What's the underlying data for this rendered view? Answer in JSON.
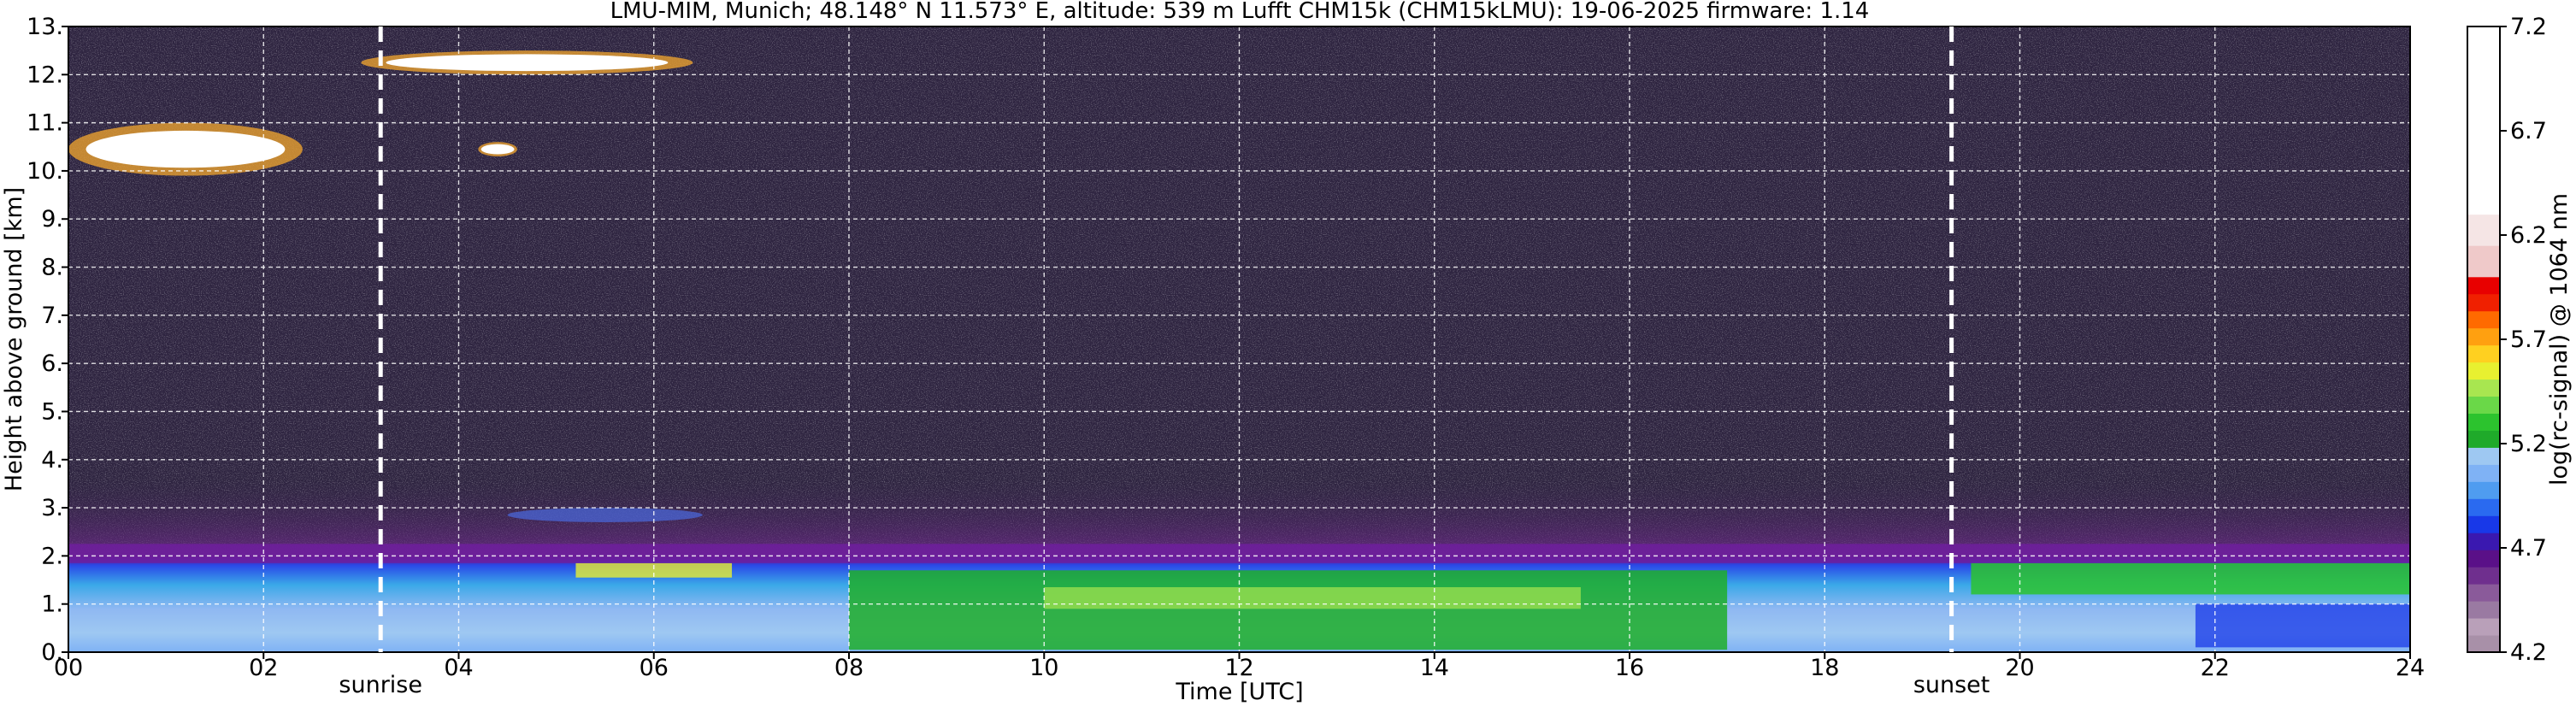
{
  "title": "LMU-MIM, Munich; 48.148° N 11.573° E, altitude: 539 m    Lufft CHM15k (CHM15kLMU): 19-06-2025    firmware: 1.14",
  "chart_data": {
    "type": "heatmap",
    "xlabel": "Time [UTC]",
    "ylabel": "Height above ground [km]",
    "xlim": [
      0,
      24
    ],
    "ylim": [
      0,
      13
    ],
    "x_ticks": [
      "00",
      "02",
      "04",
      "06",
      "08",
      "10",
      "12",
      "14",
      "16",
      "18",
      "20",
      "22",
      "24"
    ],
    "y_ticks": [
      "0.",
      "1.",
      "2.",
      "3.",
      "4.",
      "5.",
      "6.",
      "7.",
      "8.",
      "9.",
      "10.",
      "11.",
      "12.",
      "13."
    ],
    "grid": true,
    "markers": [
      {
        "label": "sunrise",
        "x": 3.2
      },
      {
        "label": "sunset",
        "x": 19.3
      }
    ],
    "colorbar": {
      "label": "log(rc-signal) @ 1064 nm",
      "range": [
        4.2,
        7.2
      ],
      "ticks": [
        "4.2",
        "4.7",
        "5.2",
        "5.7",
        "6.2",
        "6.7",
        "7.2"
      ],
      "colors": [
        "#a890a8",
        "#b9a0b9",
        "#9a7aa2",
        "#8a5a9a",
        "#6f2f8e",
        "#5a1088",
        "#3a18b0",
        "#1838e8",
        "#2a6af0",
        "#4f9cf0",
        "#7fb2f5",
        "#9ec8f2",
        "#1faa2a",
        "#2cc32e",
        "#6ad848",
        "#a8e650",
        "#e8f030",
        "#ffd020",
        "#ffa010",
        "#ff6a00",
        "#f02000",
        "#e80000",
        "#efc9c9",
        "#f5e5e5",
        "#ffffff"
      ]
    },
    "features": [
      {
        "name": "boundary layer aerosol",
        "time": [
          0,
          24
        ],
        "height_km": [
          0,
          2.0
        ]
      },
      {
        "name": "residual/elevated layer",
        "time": [
          0,
          24
        ],
        "height_km": [
          1.8,
          2.2
        ]
      },
      {
        "name": "cirrus cloud",
        "time": [
          3.0,
          6.4
        ],
        "height_km": [
          12.0,
          12.5
        ]
      },
      {
        "name": "cirrus cloud",
        "time": [
          0.0,
          2.4
        ],
        "height_km": [
          9.9,
          11.0
        ]
      },
      {
        "name": "cirrus fragment",
        "time": [
          4.2,
          4.6
        ],
        "height_km": [
          10.3,
          10.6
        ]
      },
      {
        "name": "thin aerosol layer",
        "time": [
          4.5,
          6.5
        ],
        "height_km": [
          2.7,
          3.0
        ]
      }
    ]
  }
}
